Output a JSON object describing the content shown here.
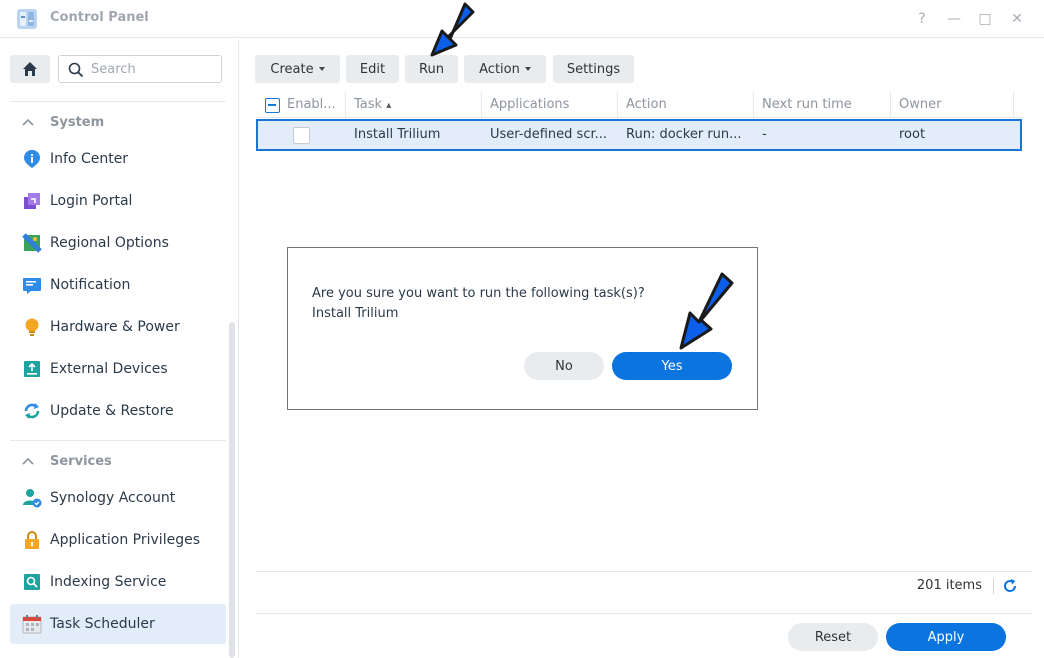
{
  "window": {
    "title": "Control Panel",
    "controls": {
      "help": "?",
      "minimize": "—",
      "maximize": "□",
      "close": "✕"
    }
  },
  "sidebar": {
    "search_placeholder": "Search",
    "sections": [
      {
        "label": "System",
        "items": [
          {
            "label": "Info Center",
            "icon": "info-icon"
          },
          {
            "label": "Login Portal",
            "icon": "login-portal-icon"
          },
          {
            "label": "Regional Options",
            "icon": "regional-options-icon"
          },
          {
            "label": "Notification",
            "icon": "notification-icon"
          },
          {
            "label": "Hardware & Power",
            "icon": "lightbulb-icon"
          },
          {
            "label": "External Devices",
            "icon": "external-devices-icon"
          },
          {
            "label": "Update & Restore",
            "icon": "update-restore-icon"
          }
        ]
      },
      {
        "label": "Services",
        "items": [
          {
            "label": "Synology Account",
            "icon": "account-icon"
          },
          {
            "label": "Application Privileges",
            "icon": "lock-icon"
          },
          {
            "label": "Indexing Service",
            "icon": "indexing-icon"
          },
          {
            "label": "Task Scheduler",
            "icon": "calendar-icon",
            "selected": true
          }
        ]
      }
    ]
  },
  "toolbar": {
    "create": "Create",
    "edit": "Edit",
    "run": "Run",
    "action": "Action",
    "settings": "Settings"
  },
  "table": {
    "columns": [
      "Enabl...",
      "Task",
      "Applications",
      "Action",
      "Next run time",
      "Owner"
    ],
    "sort_indicator": "▴",
    "rows": [
      {
        "enabled": false,
        "task": "Install Trilium",
        "applications": "User-defined scr...",
        "action": "Run: docker run...",
        "next_run_time": "-",
        "owner": "root"
      }
    ]
  },
  "footer": {
    "item_count": "201 items",
    "reset": "Reset",
    "apply": "Apply"
  },
  "dialog": {
    "message": "Are you sure you want to run the following task(s)?",
    "task_name": "Install Trilium",
    "no": "No",
    "yes": "Yes"
  },
  "colors": {
    "accent": "#0b74de",
    "selection": "#e3edf9",
    "annotation_arrow": "#0b5fe8"
  }
}
